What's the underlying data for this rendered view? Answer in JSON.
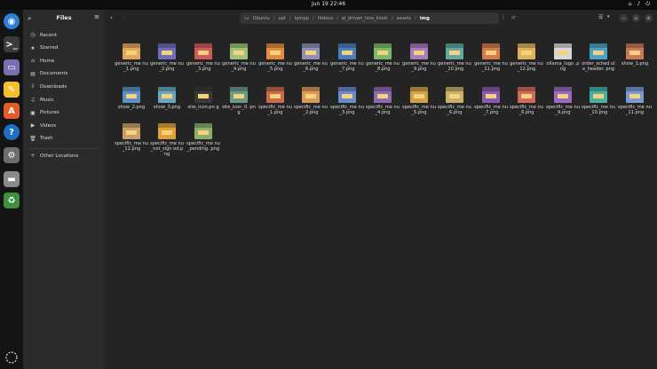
{
  "topbar": {
    "clock": "Jun 19  22:46",
    "sys": "⌂ ♪ ⏻"
  },
  "dock": [
    {
      "name": "chrome-icon",
      "glyph": "◉",
      "bg": "#2f7fd6"
    },
    {
      "name": "terminal-icon",
      "glyph": ">_",
      "bg": "#3b3b3b"
    },
    {
      "name": "files-icon",
      "glyph": "▭",
      "bg": "#7a6fb0"
    },
    {
      "name": "text-editor-icon",
      "glyph": "✎",
      "bg": "#f3c02d"
    },
    {
      "name": "app-center-icon",
      "glyph": "A",
      "bg": "#e55b26"
    },
    {
      "name": "help-icon",
      "glyph": "?",
      "bg": "#1c6fc2"
    },
    {
      "name": "settings-icon",
      "glyph": "⚙",
      "bg": "#6c6c6c"
    },
    {
      "name": "disc-icon",
      "glyph": "▬",
      "bg": "#8a8a8a"
    },
    {
      "name": "trash-icon",
      "glyph": "♻",
      "bg": "#3f8f3f"
    }
  ],
  "sidebar": {
    "title": "Files",
    "items": [
      {
        "label": "Recent",
        "icon": "◷",
        "name": "sidebar-item-recent"
      },
      {
        "label": "Starred",
        "icon": "★",
        "name": "sidebar-item-starred"
      },
      {
        "label": "Home",
        "icon": "⌂",
        "name": "sidebar-item-home"
      },
      {
        "label": "Documents",
        "icon": "▤",
        "name": "sidebar-item-documents"
      },
      {
        "label": "Downloads",
        "icon": "⇩",
        "name": "sidebar-item-downloads"
      },
      {
        "label": "Music",
        "icon": "♫",
        "name": "sidebar-item-music"
      },
      {
        "label": "Pictures",
        "icon": "▣",
        "name": "sidebar-item-pictures"
      },
      {
        "label": "Videos",
        "icon": "▶",
        "name": "sidebar-item-videos"
      },
      {
        "label": "Trash",
        "icon": "🗑",
        "name": "sidebar-item-trash"
      }
    ],
    "other": {
      "label": "Other Locations",
      "icon": "+"
    }
  },
  "path": [
    "Ubuntu",
    "opt",
    "lampp",
    "htdocs",
    "ai_driven_lora_kiosk",
    "assets",
    "img"
  ],
  "files": [
    {
      "name": "generic_me nu_1.png",
      "color": "#e0a85c"
    },
    {
      "name": "generic_me nu_2.png",
      "color": "#6d6fb8"
    },
    {
      "name": "generic_me nu_3.png",
      "color": "#d05a5a"
    },
    {
      "name": "generic_me nu_4.png",
      "color": "#9fc27a"
    },
    {
      "name": "generic_me nu_5.png",
      "color": "#e48a3c"
    },
    {
      "name": "generic_me nu_6.png",
      "color": "#8f8fb8"
    },
    {
      "name": "generic_me nu_7.png",
      "color": "#4a7fbf"
    },
    {
      "name": "generic_me nu_8.png",
      "color": "#7cb86a"
    },
    {
      "name": "generic_me nu_9.png",
      "color": "#a77ac2"
    },
    {
      "name": "generic_me nu_10.png",
      "color": "#62a8a0"
    },
    {
      "name": "generic_me nu_11.png",
      "color": "#d8794b"
    },
    {
      "name": "generic_me nu_12.png",
      "color": "#e0b25c"
    },
    {
      "name": "ollama_logo .png",
      "color": "#d8d8d8"
    },
    {
      "name": "order_sched ule_header. png",
      "color": "#4aa3c9"
    },
    {
      "name": "show_1.png",
      "color": "#c9785a"
    },
    {
      "name": "show_2.png",
      "color": "#5a8fc9"
    },
    {
      "name": "show_3.png",
      "color": "#6aa8c0"
    },
    {
      "name": "site_icon.pn g",
      "color": "#3a3a3a"
    },
    {
      "name": "site_icon_0. png",
      "color": "#6a9a8a"
    },
    {
      "name": "specific_me nu_1.png",
      "color": "#c96a4a"
    },
    {
      "name": "specific_me nu_2.png",
      "color": "#d89a5a"
    },
    {
      "name": "specific_me nu_3.png",
      "color": "#6a8ad0"
    },
    {
      "name": "specific_me nu_4.png",
      "color": "#8a6ab0"
    },
    {
      "name": "specific_me nu_5.png",
      "color": "#d0a04a"
    },
    {
      "name": "specific_me nu_6.png",
      "color": "#c9b06a"
    },
    {
      "name": "specific_me nu_7.png",
      "color": "#8a5ab0"
    },
    {
      "name": "specific_me nu_8.png",
      "color": "#d06a5a"
    },
    {
      "name": "specific_me nu_9.png",
      "color": "#9a6ac0"
    },
    {
      "name": "specific_me nu_10.png",
      "color": "#4ab0a0"
    },
    {
      "name": "specific_me nu_11.png",
      "color": "#7a9ad0"
    },
    {
      "name": "specific_me nu_12.png",
      "color": "#c9a06a"
    },
    {
      "name": "specific_me nu_not_sign ed.png",
      "color": "#e0a03a"
    },
    {
      "name": "specific_me nu_pending. png",
      "color": "#8ab06a"
    }
  ]
}
